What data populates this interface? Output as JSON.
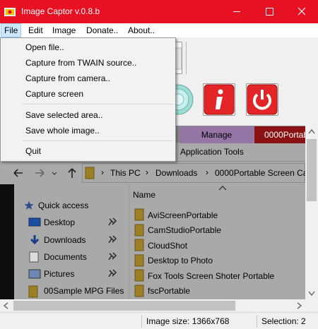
{
  "window": {
    "title": "Image Captor v.0.8.b"
  },
  "menubar": {
    "items": [
      "File",
      "Edit",
      "Image",
      "Donate..",
      "About.."
    ]
  },
  "file_menu": {
    "items": [
      "Open file..",
      "Capture from TWAIN source..",
      "Capture from camera..",
      "Capture screen",
      "Save selected area..",
      "Save whole image..",
      "Quit"
    ]
  },
  "captured": {
    "ribbon": {
      "manage_tab": "Manage",
      "portable_tab": "0000Portab",
      "app_tools_tab": "Application Tools"
    },
    "address": {
      "path": [
        "This PC",
        "Downloads",
        "0000Portable Screen Ca"
      ]
    },
    "sidebar": {
      "quick_access": "Quick access",
      "items": [
        "Desktop",
        "Downloads",
        "Documents",
        "Pictures",
        "00Sample MPG Files"
      ]
    },
    "file_list": {
      "column_name": "Name",
      "files": [
        "AviScreenPortable",
        "CamStudioPortable",
        "CloudShot",
        "Desktop to Photo",
        "Fox Tools Screen Shoter Portable",
        "fscPortable"
      ]
    }
  },
  "status": {
    "image_size": "Image size: 1366x768",
    "selection": "Selection: 2"
  },
  "colors": {
    "titlebar": "#e81123",
    "menu_highlight": "#cce8ff",
    "viewer_gray": "#a9a9a9"
  }
}
